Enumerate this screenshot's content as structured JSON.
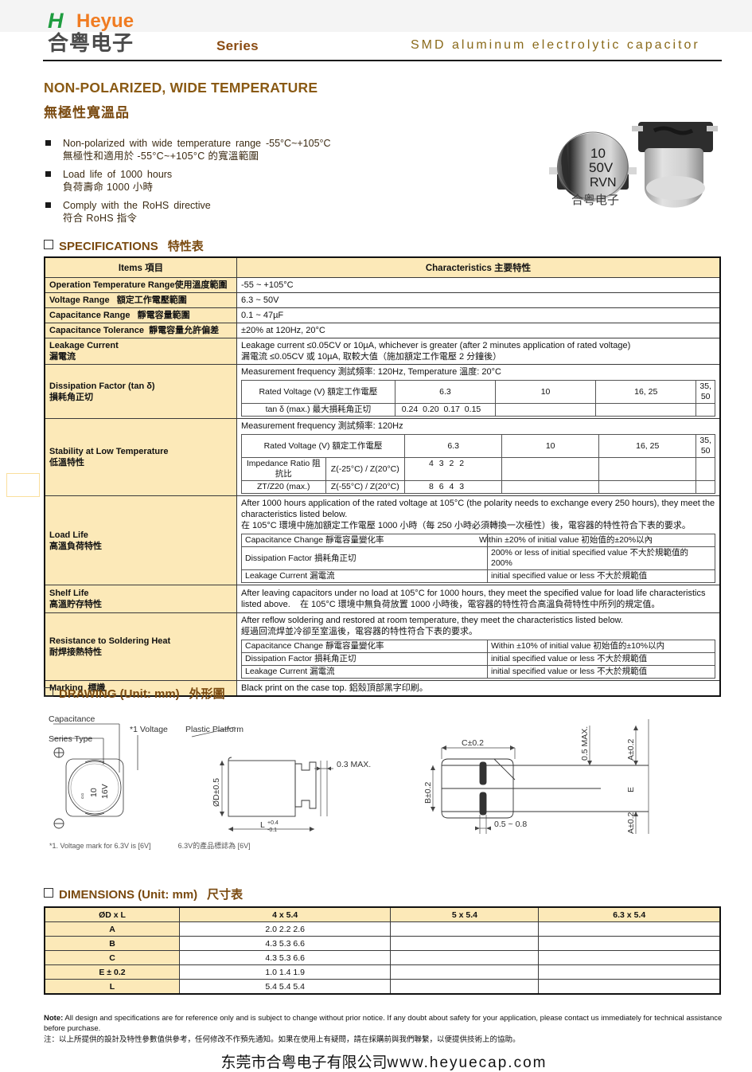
{
  "header": {
    "logo_letter": "H",
    "logo_name": "Heyue",
    "logo_cn": "合粤电子",
    "series_label": "Series",
    "title": "SMD aluminum electrolytic capacitor"
  },
  "intro": {
    "title_en": "NON-POLARIZED, WIDE TEMPERATURE",
    "title_cn": "無極性寬溫品",
    "bullets": [
      {
        "en": "Non-polarized with wide temperature range -55°C~+105°C",
        "cn": "無極性和適用於 -55°C~+105°C 的寬溫範圍"
      },
      {
        "en": "Load life of 1000 hours",
        "cn": "負荷壽命 1000 小時"
      },
      {
        "en": "Comply with the RoHS directive",
        "cn": "符合 RoHS 指令"
      }
    ],
    "photo_marking": [
      "10",
      "50V",
      "RVN"
    ],
    "photo_brand": "合粤电子"
  },
  "specifications": {
    "heading_en": "SPECIFICATIONS",
    "heading_cn": "特性表",
    "col_items": "Items  項目",
    "col_characteristics": "Characteristics  主要特性",
    "rows": {
      "operation_temp": {
        "label_en": "Operation Temperature Range",
        "label_cn": "使用溫度範圍",
        "value": "-55 ~ +105°C"
      },
      "voltage_range": {
        "label_en": "Voltage Range",
        "label_cn": "額定工作電壓範圍",
        "value": "6.3 ~ 50V"
      },
      "capacitance_range": {
        "label_en": "Capacitance Range",
        "label_cn": "靜電容量範圍",
        "value": "0.1 ~ 47µF"
      },
      "capacitance_tolerance": {
        "label_en": "Capacitance Tolerance",
        "label_cn": "靜電容量允許偏差",
        "value": "±20% at 120Hz, 20°C"
      },
      "leakage_current": {
        "label_en": "Leakage Current",
        "label_cn": "漏電流",
        "line_en": "Leakage current ≤0.05CV or 10µA, whichever is greater (after 2 minutes application of rated voltage)",
        "line_cn": "漏電流 ≤0.05CV 或 10µA, 取較大值（施加額定工作電壓 2 分鐘後）"
      },
      "dissipation_factor": {
        "label_en": "Dissipation Factor (tan δ)",
        "label_cn": "損耗角正切",
        "meas": "Measurement frequency  測試頻率: 120Hz, Temperature  溫度: 20°C",
        "row_voltage_label": "Rated Voltage (V)  額定工作電壓",
        "voltages": [
          "6.3",
          "10",
          "16, 25",
          "35, 50"
        ],
        "row_tan_label": "tan δ (max.)  最大損耗角正切",
        "tan_values": "0.24 0.20 0.17 0.15"
      },
      "stability_low_temp": {
        "label_en": "Stability at Low Temperature",
        "label_cn": "低溫特性",
        "meas": "Measurement frequency  測試頻率: 120Hz",
        "row_voltage_label": "Rated Voltage (V)  額定工作電壓",
        "voltages": [
          "6.3",
          "10",
          "16, 25",
          "35, 50"
        ],
        "ratio_label_1": "Impedance Ratio  阻抗比",
        "ratio_label_2": "ZT/Z20 (max.)",
        "cond_1": "Z(-25°C) / Z(20°C)",
        "cond_2": "Z(-55°C) / Z(20°C)",
        "values_1": "4 3 2 2",
        "values_2": "8 6 4 3"
      },
      "load_life": {
        "label_en": "Load Life",
        "label_cn": "高溫負荷特性",
        "desc_en": "After 1000 hours application of the rated voltage at 105°C (the polarity needs to exchange every 250 hours), they meet the characteristics listed below.",
        "desc_cn": "在 105°C 環境中施加額定工作電壓 1000 小時（每 250 小時必須轉換一次極性）後，電容器的特性符合下表的要求。",
        "items": [
          {
            "name": "Capacitance Change  靜電容量變化率",
            "value": "Within      ±20% of initial value  初始值的±20%以內"
          },
          {
            "name": "Dissipation Factor  損耗角正切",
            "value": "200% or less of initial specified value  不大於規範值的 200%"
          },
          {
            "name": "Leakage Current  漏電流",
            "value": "initial specified value or less  不大於規範值"
          }
        ]
      },
      "shelf_life": {
        "label_en": "Shelf Life",
        "label_cn": "高溫貯存特性",
        "desc_en": "After leaving capacitors under no load at 105°C for 1000 hours, they meet the specified value for load life characteristics listed above.",
        "desc_cn": "在 105°C 環境中無負荷放置 1000 小時後，電容器的特性符合高溫負荷特性中所列的規定值。"
      },
      "resistance_soldering": {
        "label_en": "Resistance to Soldering Heat",
        "label_cn": "耐焊接熱特性",
        "desc_en": "After reflow soldering and restored at room temperature, they meet the characteristics listed below.",
        "desc_cn": "經過回流焊並冷卻至室溫後，電容器的特性符合下表的要求。",
        "items": [
          {
            "name": "Capacitance Change  靜電容量變化率",
            "value": "Within ±10% of initial value  初始值的±10%以内"
          },
          {
            "name": "Dissipation Factor  損耗角正切",
            "value": "initial specified value or less  不大於規範值"
          },
          {
            "name": "Leakage Current  漏電流",
            "value": "initial specified value or less  不大於規範值"
          }
        ]
      },
      "marking": {
        "label_en": "Marking",
        "label_cn": "標識",
        "value": "Black print on the case top.    鋁殼頂部黑字印刷。"
      }
    }
  },
  "drawing": {
    "heading_en": "DRAWING (Unit: mm)",
    "heading_cn": "外形圖",
    "labels": {
      "capacitance": "Capacitance",
      "series_type": "Series Type",
      "voltage_note": "*1 Voltage",
      "plastic_platform": "Plastic Platform",
      "top_cap": "10",
      "top_volt": "16V",
      "d_dim": "ØD±0.5",
      "l_dim": "L",
      "l_tol_up": "+0.4",
      "l_tol_dn": "-0.1",
      "gap": "0.3 MAX.",
      "c_dim": "C±0.2",
      "b_dim": "B±0.2",
      "e_dim": "E",
      "a_dim_top": "A±0.2",
      "a_dim_bot": "A±0.2",
      "h_max": "0.5 MAX.",
      "pad_w": "0.5 ~ 0.8"
    },
    "footnote_en": "*1. Voltage mark for 6.3V is [6V]",
    "footnote_cn": "6.3V的產品標誌為 [6V]"
  },
  "dimensions": {
    "heading_en": "DIMENSIONS (Unit: mm)",
    "heading_cn": "尺寸表",
    "columns": [
      "ØD x L",
      "4 x 5.4",
      "5 x 5.4",
      "6.3 x 5.4"
    ],
    "rows": [
      {
        "label": "A",
        "values": [
          "2.0 2.2 2.6",
          "",
          ""
        ]
      },
      {
        "label": "B",
        "values": [
          "4.3 5.3 6.6",
          "",
          ""
        ]
      },
      {
        "label": "C",
        "values": [
          "4.3 5.3 6.6",
          "",
          ""
        ]
      },
      {
        "label": "E ± 0.2",
        "values": [
          "1.0 1.4 1.9",
          "",
          ""
        ]
      },
      {
        "label": "L",
        "values": [
          "5.4 5.4 5.4",
          "",
          ""
        ]
      }
    ]
  },
  "footer": {
    "note_prefix": "Note:",
    "note_en": " All design and specifications are for reference only and is subject to change without prior notice. If any doubt about safety for your application, please contact us immediately for technical assistance before purchase.",
    "note_cn": "注：以上所提供的設計及特性參數值供參考，任何修改不作預先通知。如果在使用上有疑問，請在採購前與我們聯繫，以便提供技術上的協助。",
    "company_cn": "东莞市合粤电子有限公司",
    "website": "www.heyuecap.com"
  },
  "colors": {
    "brand_orange": "#f07c22",
    "brand_green": "#1e9c3f",
    "table_header_bg": "#fce9b8",
    "title_brown": "#8a5a14"
  }
}
